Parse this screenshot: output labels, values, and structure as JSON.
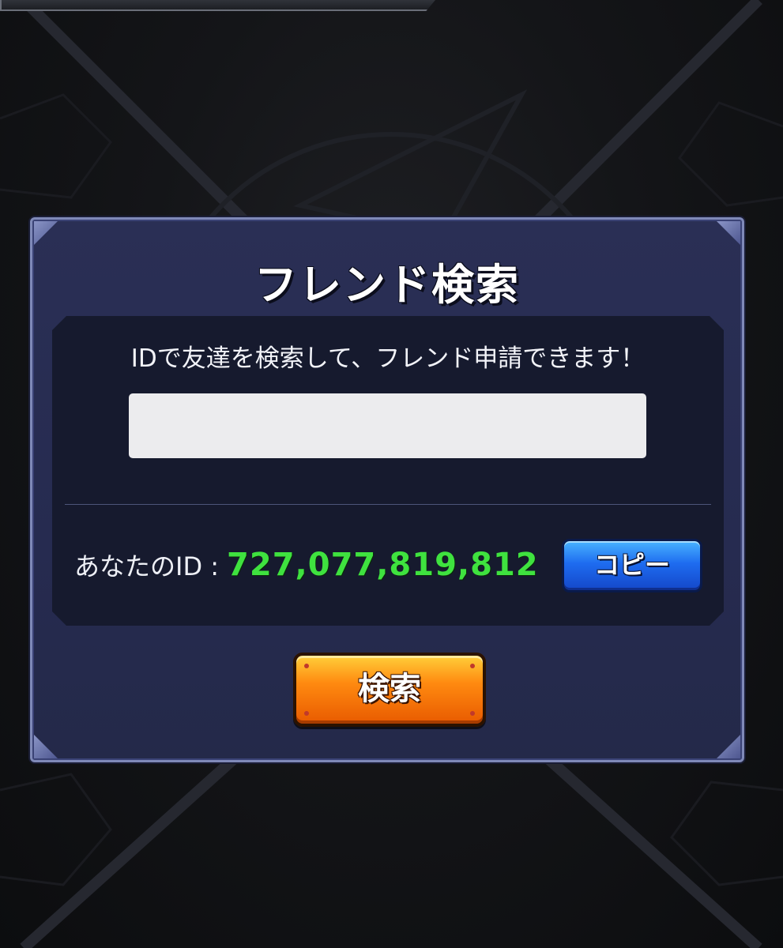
{
  "dialog": {
    "title": "フレンド検索",
    "instruction": "IDで友達を検索して、フレンド申請できます！",
    "search_input": {
      "value": "",
      "placeholder": ""
    },
    "your_id_label": "あなたのID :",
    "your_id_value": "727,077,819,812",
    "copy_button_label": "コピー",
    "search_button_label": "検索"
  },
  "colors": {
    "dialog_bg": "#2a2f55",
    "panel_bg": "#161a2e",
    "id_value": "#3fe23f",
    "copy_button": "#1e6cf0",
    "search_button": "#ff8a10"
  }
}
